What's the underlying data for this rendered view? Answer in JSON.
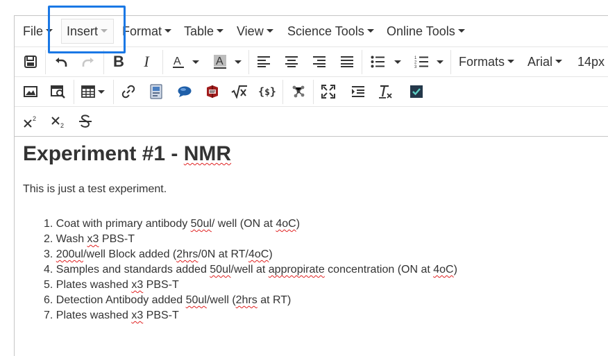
{
  "menubar": {
    "items": [
      {
        "label": "File"
      },
      {
        "label": "Insert"
      },
      {
        "label": "Format"
      },
      {
        "label": "Table"
      },
      {
        "label": "View"
      },
      {
        "label": "Science Tools"
      },
      {
        "label": "Online Tools"
      }
    ]
  },
  "toolbar": {
    "formats_label": "Formats",
    "font_family": "Arial",
    "font_size": "14px",
    "accent_color": "#1a78e5"
  },
  "icons": [
    "save-icon",
    "undo-icon",
    "redo-icon",
    "bold-icon",
    "italic-icon",
    "text-color-icon",
    "background-color-icon",
    "align-left-icon",
    "align-center-icon",
    "align-right-icon",
    "justify-icon",
    "bullet-list-icon",
    "numbered-list-icon",
    "image-icon",
    "preview-icon",
    "table-icon",
    "link-icon",
    "media-icon",
    "comment-icon",
    "book-icon",
    "formula-icon",
    "code-icon",
    "molecule-icon",
    "fullscreen-icon",
    "indent-icon",
    "clear-format-icon",
    "spellcheck-icon",
    "superscript-icon",
    "subscript-icon",
    "strikethrough-icon"
  ],
  "document": {
    "title_prefix": "Experiment #1 - ",
    "title_word": "NMR",
    "intro": "This is just a test experiment.",
    "steps": [
      {
        "n": "1.",
        "a": "Coat with primary antibody ",
        "b": "50ul",
        "c": "/ well (ON at ",
        "d": "4oC",
        "e": ")"
      },
      {
        "n": "2.",
        "a": "Wash ",
        "b": "x3",
        "c": " PBS-T"
      },
      {
        "n": "3.",
        "b": "200ul",
        "c": "/well Block added (",
        "d": "2hrs",
        "e": "/0N at RT/",
        "f": "4oC",
        "g": ")"
      },
      {
        "n": "4.",
        "a": "Samples and standards added ",
        "b": "50ul",
        "c": "/well at ",
        "d": "appropirate",
        "e": " concentration (ON at ",
        "f": "4oC",
        "g": ")"
      },
      {
        "n": "5.",
        "a": "Plates washed ",
        "b": "x3",
        "c": " PBS-T"
      },
      {
        "n": "6.",
        "a": "Detection Antibody added ",
        "b": "50ul",
        "c": "/well (",
        "d": "2hrs",
        "e": " at RT)"
      },
      {
        "n": "7.",
        "a": "Plates washed ",
        "b": "x3",
        "c": " PBS-T"
      }
    ]
  }
}
